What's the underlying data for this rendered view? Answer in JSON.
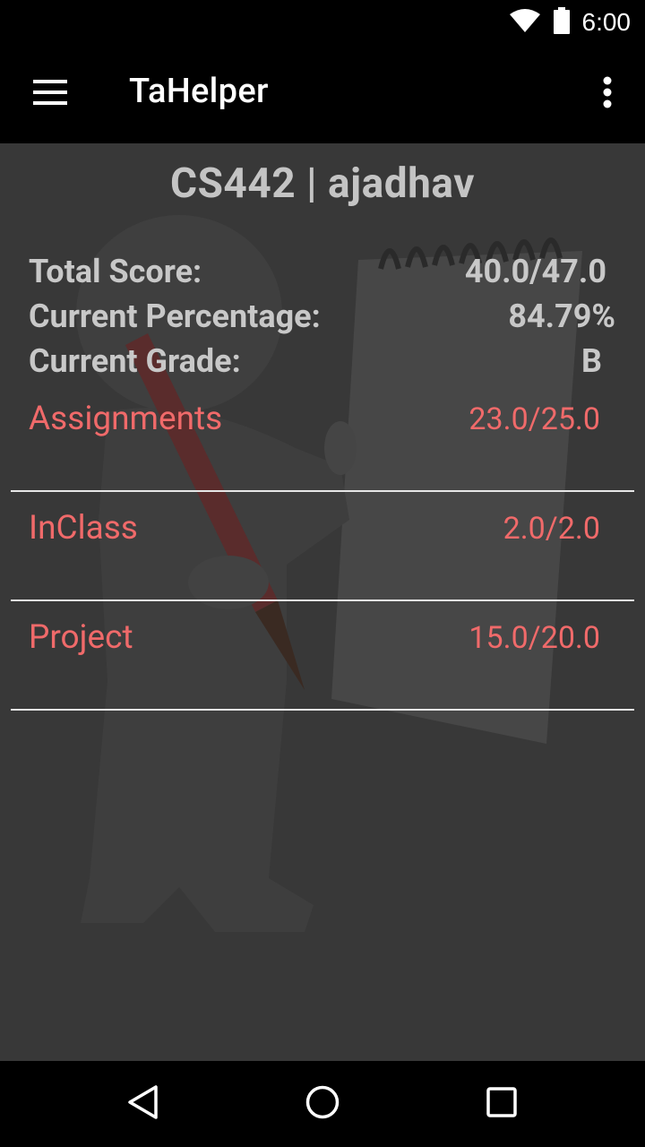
{
  "status_bar": {
    "time": "6:00",
    "icons": [
      "wifi-icon",
      "battery-icon"
    ]
  },
  "app_bar": {
    "title": "TaHelper",
    "menu_icon": "hamburger-menu-icon",
    "overflow_icon": "more-vert-icon"
  },
  "main": {
    "heading": "CS442 | ajadhav",
    "summary": {
      "total_score_label": "Total Score:",
      "total_score_value": "40.0/47.0",
      "percentage_label": "Current Percentage:",
      "percentage_value": "84.79%",
      "grade_label": "Current Grade:",
      "grade_value": "B"
    },
    "categories": [
      {
        "label": "Assignments",
        "score": "23.0/25.0"
      },
      {
        "label": "InClass",
        "score": "2.0/2.0"
      },
      {
        "label": "Project",
        "score": "15.0/20.0"
      }
    ]
  },
  "nav_bar": {
    "icons": [
      "back-icon",
      "home-icon",
      "recents-icon"
    ]
  },
  "colors": {
    "accent": "#f06a6a",
    "summary_text": "#c8c8c8",
    "content_background": "#383838"
  }
}
